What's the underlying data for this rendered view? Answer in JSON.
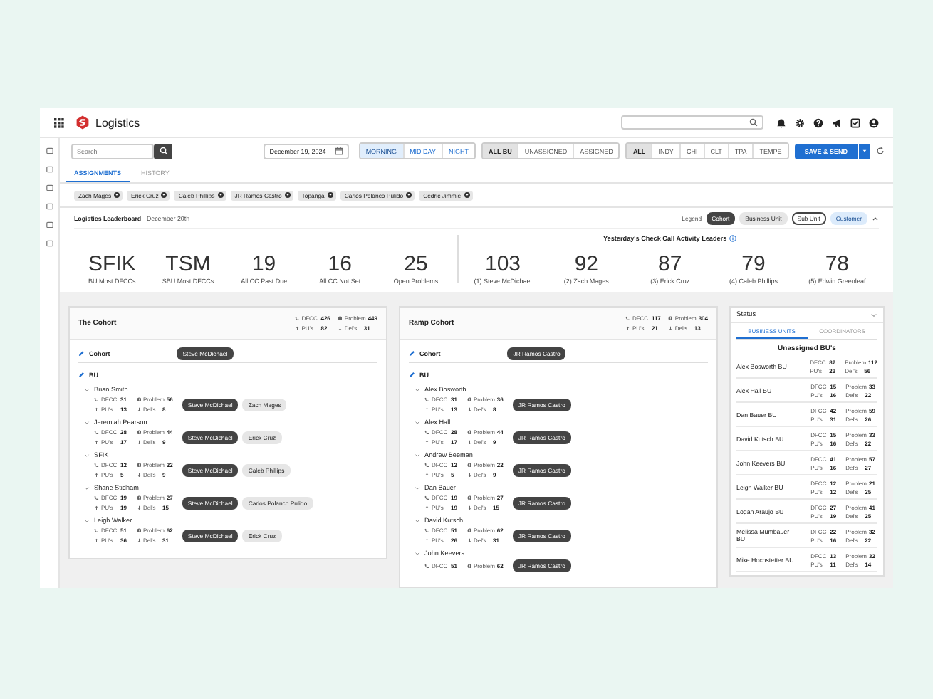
{
  "app": {
    "title": "Logistics"
  },
  "toolbar": {
    "search_placeholder": "Search",
    "date": "December 19, 2024",
    "shifts": [
      {
        "label": "MORNING",
        "selected": true
      },
      {
        "label": "MID DAY",
        "selected": false
      },
      {
        "label": "NIGHT",
        "selected": false
      }
    ],
    "bu_filters": [
      {
        "label": "ALL BU",
        "selected": true
      },
      {
        "label": "UNASSIGNED",
        "selected": false
      },
      {
        "label": "ASSIGNED",
        "selected": false
      }
    ],
    "cities": [
      {
        "label": "ALL",
        "selected": true
      },
      {
        "label": "INDY",
        "selected": false
      },
      {
        "label": "CHI",
        "selected": false
      },
      {
        "label": "CLT",
        "selected": false
      },
      {
        "label": "TPA",
        "selected": false
      },
      {
        "label": "TEMPE",
        "selected": false
      }
    ],
    "save_label": "SAVE & SEND"
  },
  "tabs": [
    {
      "label": "ASSIGNMENTS",
      "selected": true
    },
    {
      "label": "HISTORY",
      "selected": false
    }
  ],
  "chips": [
    "Zach Mages",
    "Erick Cruz",
    "Caleb Phillips",
    "JR Ramos Castro",
    "Topanga",
    "Carlos Polanco Pulido",
    "Cedric Jimmie"
  ],
  "leaderboard": {
    "title": "**Logistics Leaderboard** · December 20th",
    "legend_label": "Legend",
    "legend": [
      {
        "label": "Cohort",
        "kind": "cohort"
      },
      {
        "label": "Business Unit",
        "kind": "business_unit"
      },
      {
        "label": "Sub Unit",
        "kind": "sub_unit"
      },
      {
        "label": "Customer",
        "kind": "customer"
      }
    ],
    "stats": [
      {
        "value": "SFIK",
        "label": "BU Most DFCCs"
      },
      {
        "value": "TSM",
        "label": "SBU Most DFCCs"
      },
      {
        "value": "19",
        "label": "All CC Past Due"
      },
      {
        "value": "16",
        "label": "All CC Not Set"
      },
      {
        "value": "25",
        "label": "Open Problems"
      }
    ],
    "leaders_title": "Yesterday's Check Call Activity Leaders",
    "leaders": [
      {
        "value": "103",
        "label": "(1) Steve McDichael"
      },
      {
        "value": "92",
        "label": "(2) Zach Mages"
      },
      {
        "value": "87",
        "label": "(3) Erick Cruz"
      },
      {
        "value": "79",
        "label": "(4) Caleb Phillips"
      },
      {
        "value": "78",
        "label": "(5) Edwin Greenleaf"
      }
    ]
  },
  "panels": [
    {
      "title": "The Cohort",
      "metrics": [
        {
          "kind": "dfcc",
          "label": "DFCC",
          "value": "426"
        },
        {
          "kind": "problem",
          "label": "Problem",
          "value": "449"
        },
        {
          "kind": "pickups",
          "label": "PU's",
          "value": "82"
        },
        {
          "kind": "deliveries",
          "label": "Del's",
          "value": "31"
        }
      ],
      "cohort_label": "Cohort",
      "cohort_tag": {
        "label": "Steve McDichael",
        "kind": "cohort"
      },
      "bu_label": "BU",
      "units": [
        {
          "name": "Brian Smith",
          "expanded": true,
          "metrics": [
            {
              "kind": "dfcc",
              "label": "DFCC",
              "value": "31"
            },
            {
              "kind": "problem",
              "label": "Problem",
              "value": "56"
            },
            {
              "kind": "pickups",
              "label": "PU's",
              "value": "13"
            },
            {
              "kind": "deliveries",
              "label": "Del's",
              "value": "8"
            }
          ],
          "tags": [
            {
              "label": "Steve McDichael",
              "kind": "cohort"
            },
            {
              "label": "Zach Mages",
              "kind": "business_unit"
            }
          ]
        },
        {
          "name": "Jeremiah Pearson",
          "expanded": true,
          "metrics": [
            {
              "kind": "dfcc",
              "label": "DFCC",
              "value": "28"
            },
            {
              "kind": "problem",
              "label": "Problem",
              "value": "44"
            },
            {
              "kind": "pickups",
              "label": "PU's",
              "value": "17"
            },
            {
              "kind": "deliveries",
              "label": "Del's",
              "value": "9"
            }
          ],
          "tags": [
            {
              "label": "Steve McDichael",
              "kind": "cohort"
            },
            {
              "label": "Erick Cruz",
              "kind": "business_unit"
            }
          ]
        },
        {
          "name": "SFIK",
          "expanded": true,
          "metrics": [
            {
              "kind": "dfcc",
              "label": "DFCC",
              "value": "12"
            },
            {
              "kind": "problem",
              "label": "Problem",
              "value": "22"
            },
            {
              "kind": "pickups",
              "label": "PU's",
              "value": "5"
            },
            {
              "kind": "deliveries",
              "label": "Del's",
              "value": "9"
            }
          ],
          "tags": [
            {
              "label": "Steve McDichael",
              "kind": "cohort"
            },
            {
              "label": "Caleb Phillips",
              "kind": "business_unit"
            }
          ]
        },
        {
          "name": "Shane Stidham",
          "expanded": true,
          "metrics": [
            {
              "kind": "dfcc",
              "label": "DFCC",
              "value": "19"
            },
            {
              "kind": "problem",
              "label": "Problem",
              "value": "27"
            },
            {
              "kind": "pickups",
              "label": "PU's",
              "value": "19"
            },
            {
              "kind": "deliveries",
              "label": "Del's",
              "value": "15"
            }
          ],
          "tags": [
            {
              "label": "Steve McDichael",
              "kind": "cohort"
            },
            {
              "label": "Carlos Polanco Pulido",
              "kind": "business_unit"
            }
          ]
        },
        {
          "name": "Leigh Walker",
          "expanded": true,
          "metrics": [
            {
              "kind": "dfcc",
              "label": "DFCC",
              "value": "51"
            },
            {
              "kind": "problem",
              "label": "Problem",
              "value": "62"
            },
            {
              "kind": "pickups",
              "label": "PU's",
              "value": "36"
            },
            {
              "kind": "deliveries",
              "label": "Del's",
              "value": "31"
            }
          ],
          "tags": [
            {
              "label": "Steve McDichael",
              "kind": "cohort"
            },
            {
              "label": "Erick Cruz",
              "kind": "business_unit"
            }
          ]
        }
      ]
    },
    {
      "title": "Ramp Cohort",
      "metrics": [
        {
          "kind": "dfcc",
          "label": "DFCC",
          "value": "117"
        },
        {
          "kind": "problem",
          "label": "Problem",
          "value": "304"
        },
        {
          "kind": "pickups",
          "label": "PU's",
          "value": "21"
        },
        {
          "kind": "deliveries",
          "label": "Del's",
          "value": "13"
        }
      ],
      "cohort_label": "Cohort",
      "cohort_tag": {
        "label": "JR Ramos Castro",
        "kind": "cohort"
      },
      "bu_label": "BU",
      "units": [
        {
          "name": "Alex Bosworth",
          "expanded": true,
          "metrics": [
            {
              "kind": "dfcc",
              "label": "DFCC",
              "value": "31"
            },
            {
              "kind": "problem",
              "label": "Problem",
              "value": "36"
            },
            {
              "kind": "pickups",
              "label": "PU's",
              "value": "13"
            },
            {
              "kind": "deliveries",
              "label": "Del's",
              "value": "8"
            }
          ],
          "tags": [
            {
              "label": "JR Ramos Castro",
              "kind": "cohort"
            }
          ]
        },
        {
          "name": "Alex Hall",
          "expanded": true,
          "metrics": [
            {
              "kind": "dfcc",
              "label": "DFCC",
              "value": "28"
            },
            {
              "kind": "problem",
              "label": "Problem",
              "value": "44"
            },
            {
              "kind": "pickups",
              "label": "PU's",
              "value": "17"
            },
            {
              "kind": "deliveries",
              "label": "Del's",
              "value": "9"
            }
          ],
          "tags": [
            {
              "label": "JR Ramos Castro",
              "kind": "cohort"
            }
          ]
        },
        {
          "name": "Andrew Beeman",
          "expanded": true,
          "metrics": [
            {
              "kind": "dfcc",
              "label": "DFCC",
              "value": "12"
            },
            {
              "kind": "problem",
              "label": "Problem",
              "value": "22"
            },
            {
              "kind": "pickups",
              "label": "PU's",
              "value": "5"
            },
            {
              "kind": "deliveries",
              "label": "Del's",
              "value": "9"
            }
          ],
          "tags": [
            {
              "label": "JR Ramos Castro",
              "kind": "cohort"
            }
          ]
        },
        {
          "name": "Dan Bauer",
          "expanded": true,
          "metrics": [
            {
              "kind": "dfcc",
              "label": "DFCC",
              "value": "19"
            },
            {
              "kind": "problem",
              "label": "Problem",
              "value": "27"
            },
            {
              "kind": "pickups",
              "label": "PU's",
              "value": "19"
            },
            {
              "kind": "deliveries",
              "label": "Del's",
              "value": "15"
            }
          ],
          "tags": [
            {
              "label": "JR Ramos Castro",
              "kind": "cohort"
            }
          ]
        },
        {
          "name": "David Kutsch",
          "expanded": true,
          "metrics": [
            {
              "kind": "dfcc",
              "label": "DFCC",
              "value": "51"
            },
            {
              "kind": "problem",
              "label": "Problem",
              "value": "62"
            },
            {
              "kind": "pickups",
              "label": "PU's",
              "value": "26"
            },
            {
              "kind": "deliveries",
              "label": "Del's",
              "value": "31"
            }
          ],
          "tags": [
            {
              "label": "JR Ramos Castro",
              "kind": "cohort"
            }
          ]
        },
        {
          "name": "John Keevers",
          "expanded": true,
          "metrics": [
            {
              "kind": "dfcc",
              "label": "DFCC",
              "value": "51"
            },
            {
              "kind": "problem",
              "label": "Problem",
              "value": "62"
            }
          ],
          "tags": [
            {
              "label": "JR Ramos Castro",
              "kind": "cohort"
            }
          ]
        }
      ]
    }
  ],
  "status": {
    "title": "Status",
    "tabs": [
      {
        "label": "BUSINESS UNITS",
        "selected": true
      },
      {
        "label": "COORDINATORS",
        "selected": false
      }
    ],
    "heading": "Unassigned BU's",
    "rows": [
      {
        "name": "Alex Bosworth BU",
        "metrics": [
          {
            "label": "DFCC",
            "value": "87"
          },
          {
            "label": "Problem",
            "value": "112"
          },
          {
            "label": "PU's",
            "value": "23"
          },
          {
            "label": "Del's",
            "value": "56"
          }
        ]
      },
      {
        "name": "Alex Hall BU",
        "metrics": [
          {
            "label": "DFCC",
            "value": "15"
          },
          {
            "label": "Problem",
            "value": "33"
          },
          {
            "label": "PU's",
            "value": "16"
          },
          {
            "label": "Del's",
            "value": "22"
          }
        ]
      },
      {
        "name": "Dan Bauer BU",
        "metrics": [
          {
            "label": "DFCC",
            "value": "42"
          },
          {
            "label": "Problem",
            "value": "59"
          },
          {
            "label": "PU's",
            "value": "31"
          },
          {
            "label": "Del's",
            "value": "26"
          }
        ]
      },
      {
        "name": "David Kutsch BU",
        "metrics": [
          {
            "label": "DFCC",
            "value": "15"
          },
          {
            "label": "Problem",
            "value": "33"
          },
          {
            "label": "PU's",
            "value": "16"
          },
          {
            "label": "Del's",
            "value": "22"
          }
        ]
      },
      {
        "name": "John Keevers BU",
        "metrics": [
          {
            "label": "DFCC",
            "value": "41"
          },
          {
            "label": "Problem",
            "value": "57"
          },
          {
            "label": "PU's",
            "value": "16"
          },
          {
            "label": "Del's",
            "value": "27"
          }
        ]
      },
      {
        "name": "Leigh Walker BU",
        "metrics": [
          {
            "label": "DFCC",
            "value": "12"
          },
          {
            "label": "Problem",
            "value": "21"
          },
          {
            "label": "PU's",
            "value": "12"
          },
          {
            "label": "Del's",
            "value": "25"
          }
        ]
      },
      {
        "name": "Logan Araujo BU",
        "metrics": [
          {
            "label": "DFCC",
            "value": "27"
          },
          {
            "label": "Problem",
            "value": "41"
          },
          {
            "label": "PU's",
            "value": "19"
          },
          {
            "label": "Del's",
            "value": "25"
          }
        ]
      },
      {
        "name": "Melissa Mumbauer BU",
        "metrics": [
          {
            "label": "DFCC",
            "value": "22"
          },
          {
            "label": "Problem",
            "value": "32"
          },
          {
            "label": "PU's",
            "value": "16"
          },
          {
            "label": "Del's",
            "value": "22"
          }
        ]
      },
      {
        "name": "Mike Hochstetter BU",
        "metrics": [
          {
            "label": "DFCC",
            "value": "13"
          },
          {
            "label": "Problem",
            "value": "32"
          },
          {
            "label": "PU's",
            "value": "11"
          },
          {
            "label": "Del's",
            "value": "14"
          }
        ]
      }
    ]
  }
}
